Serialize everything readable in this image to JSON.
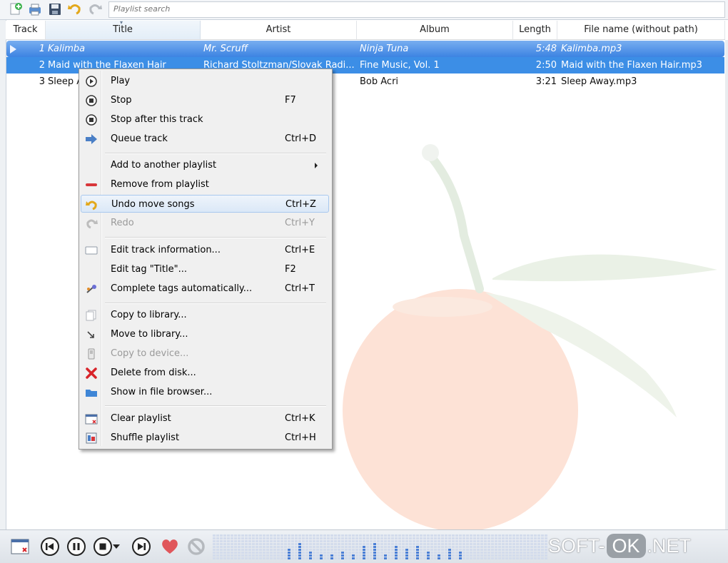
{
  "toolbar": {
    "buttons": [
      {
        "name": "new-playlist-icon"
      },
      {
        "name": "print-icon"
      },
      {
        "name": "save-icon"
      },
      {
        "name": "undo-icon"
      },
      {
        "name": "redo-icon"
      }
    ],
    "search_placeholder": "Playlist search"
  },
  "columns": {
    "track": "Track",
    "title": "Title",
    "artist": "Artist",
    "album": "Album",
    "length": "Length",
    "filename": "File name (without path)"
  },
  "rows": [
    {
      "track": "1",
      "title": "Kalimba",
      "artist": "Mr. Scruff",
      "album": "Ninja Tuna",
      "length": "5:48",
      "filename": "Kalimba.mp3",
      "state": "playing"
    },
    {
      "track": "2",
      "title": "Maid with the Flaxen Hair",
      "artist": "Richard Stoltzman/Slovak Radi...",
      "album": "Fine Music, Vol. 1",
      "length": "2:50",
      "filename": "Maid with the Flaxen Hair.mp3",
      "state": "selected"
    },
    {
      "track": "3",
      "title": "Sleep A",
      "artist": "",
      "album": "Bob Acri",
      "length": "3:21",
      "filename": "Sleep Away.mp3",
      "state": "normal"
    }
  ],
  "menu": {
    "play": {
      "label": "Play",
      "shortcut": ""
    },
    "stop": {
      "label": "Stop",
      "shortcut": "F7"
    },
    "stop_after": {
      "label": "Stop after this track",
      "shortcut": ""
    },
    "queue": {
      "label": "Queue track",
      "shortcut": "Ctrl+D"
    },
    "add_to_playlist": {
      "label": "Add to another playlist",
      "shortcut": ""
    },
    "remove": {
      "label": "Remove from playlist",
      "shortcut": ""
    },
    "undo": {
      "label": "Undo move songs",
      "shortcut": "Ctrl+Z"
    },
    "redo": {
      "label": "Redo",
      "shortcut": "Ctrl+Y"
    },
    "edit_info": {
      "label": "Edit track information...",
      "shortcut": "Ctrl+E"
    },
    "edit_tag": {
      "label": "Edit tag \"Title\"...",
      "shortcut": "F2"
    },
    "complete_tags": {
      "label": "Complete tags automatically...",
      "shortcut": "Ctrl+T"
    },
    "copy_library": {
      "label": "Copy to library...",
      "shortcut": ""
    },
    "move_library": {
      "label": "Move to library...",
      "shortcut": ""
    },
    "copy_device": {
      "label": "Copy to device...",
      "shortcut": ""
    },
    "delete_disk": {
      "label": "Delete from disk...",
      "shortcut": ""
    },
    "show_browser": {
      "label": "Show in file browser...",
      "shortcut": ""
    },
    "clear": {
      "label": "Clear playlist",
      "shortcut": "Ctrl+K"
    },
    "shuffle": {
      "label": "Shuffle playlist",
      "shortcut": "Ctrl+H"
    }
  },
  "footer": {
    "brand_left": "SOFT-",
    "brand_ok": "OK",
    "brand_right": ".NET"
  },
  "colors": {
    "selection": "#3c8ee6",
    "accent": "#78aef0"
  }
}
